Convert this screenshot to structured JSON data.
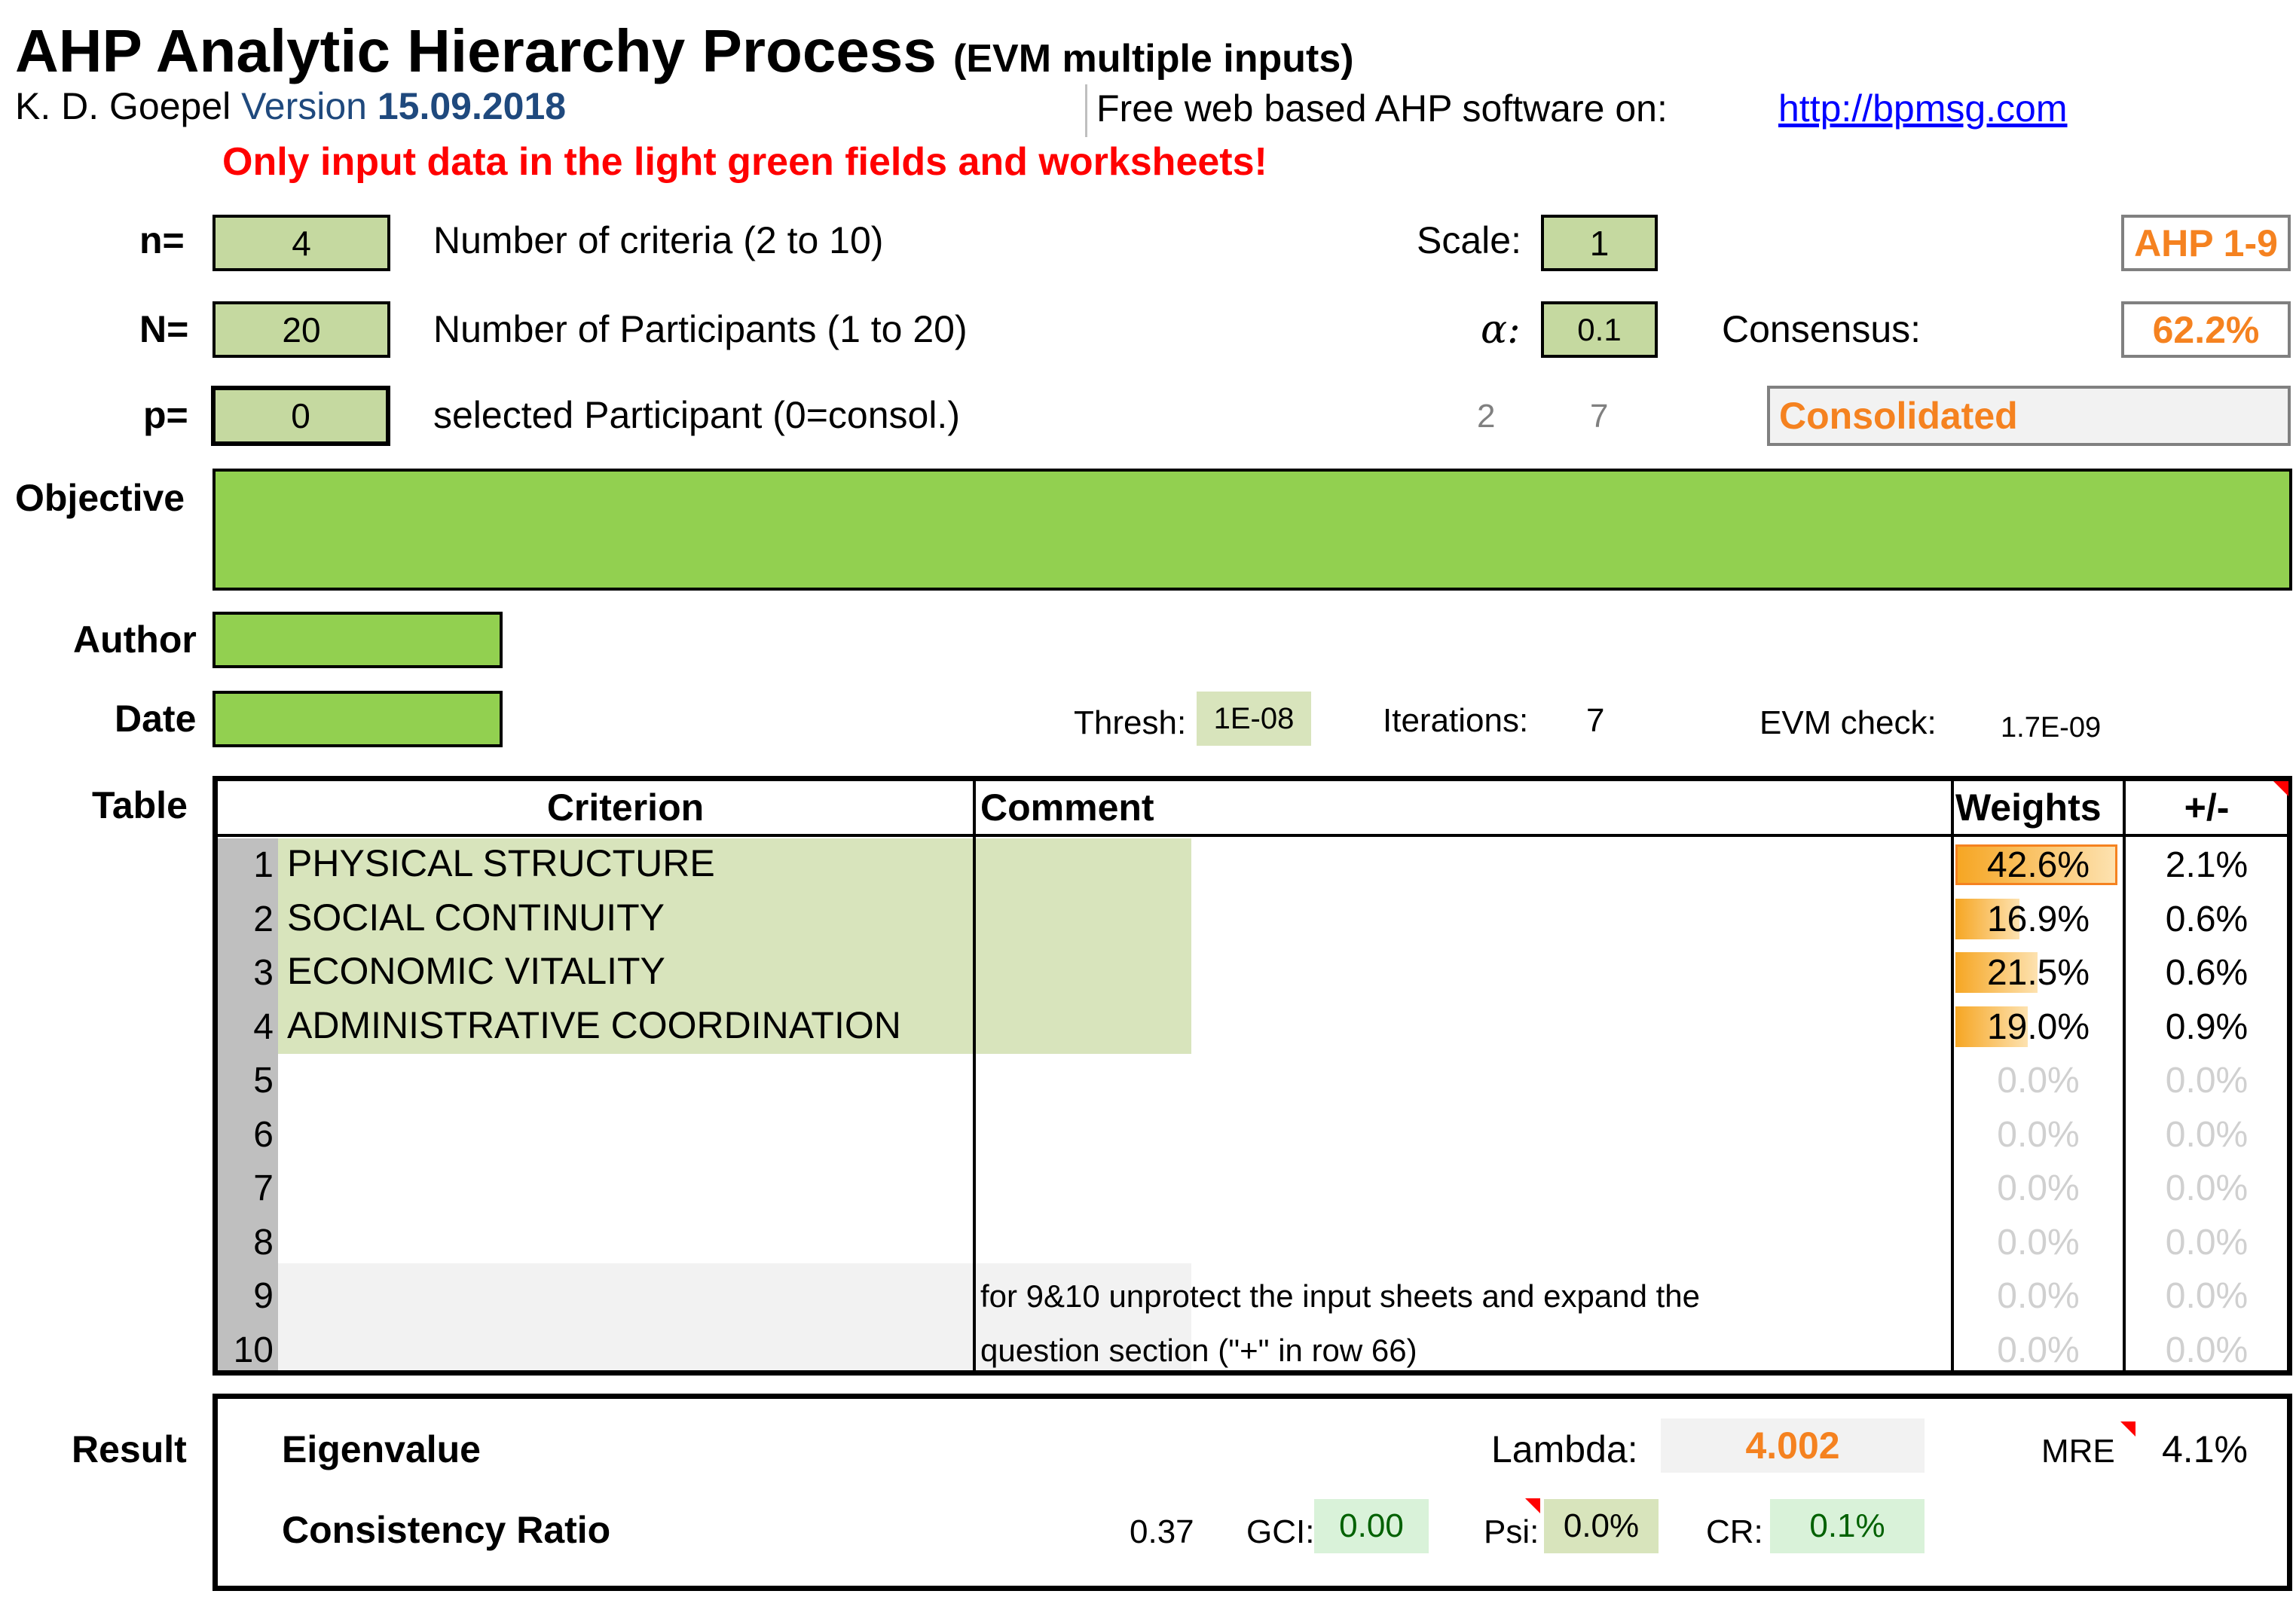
{
  "header": {
    "title": "AHP Analytic Hierarchy Process",
    "subtitle": "(EVM multiple inputs)",
    "author": "K. D. Goepel",
    "version_label": "Version",
    "version": "15.09.2018",
    "web_text": "Free web based AHP software on:",
    "web_link": "http://bpmsg.com",
    "warning": "Only input data in the light green fields and worksheets!"
  },
  "inputs": {
    "n_label": "n=",
    "n_value": "4",
    "n_desc": "Number of criteria (2 to 10)",
    "N_label": "N=",
    "N_value": "20",
    "N_desc": "Number of Participants (1 to 20)",
    "p_label": "p=",
    "p_value": "0",
    "p_desc": "selected Participant (0=consol.)",
    "scale_label": "Scale:",
    "scale_value": "1",
    "scale_name": "AHP 1-9",
    "alpha_label": "α:",
    "alpha_value": "0.1",
    "consensus_label": "Consensus:",
    "consensus_value": "62.2%",
    "aux1": "2",
    "aux2": "7",
    "participant_name": "Consolidated",
    "objective_label": "Objective",
    "author_label": "Author",
    "date_label": "Date",
    "thresh_label": "Thresh:",
    "thresh_value": "1E-08",
    "iterations_label": "Iterations:",
    "iterations_value": "7",
    "evm_label": "EVM check:",
    "evm_value": "1.7E-09"
  },
  "table": {
    "label": "Table",
    "headers": {
      "criterion": "Criterion",
      "comment": "Comment",
      "weights": "Weights",
      "pm": "+/-"
    },
    "rows": [
      {
        "num": "1",
        "criterion": "PHYSICAL STRUCTURE",
        "comment": "",
        "weight": "42.6%",
        "weight_value": 0.426,
        "pm": "2.1%"
      },
      {
        "num": "2",
        "criterion": "SOCIAL CONTINUITY",
        "comment": "",
        "weight": "16.9%",
        "weight_value": 0.169,
        "pm": "0.6%"
      },
      {
        "num": "3",
        "criterion": "ECONOMIC VITALITY",
        "comment": "",
        "weight": "21.5%",
        "weight_value": 0.215,
        "pm": "0.6%"
      },
      {
        "num": "4",
        "criterion": "ADMINISTRATIVE COORDINATION",
        "comment": "",
        "weight": "19.0%",
        "weight_value": 0.19,
        "pm": "0.9%"
      },
      {
        "num": "5",
        "criterion": "",
        "comment": "",
        "weight": "0.0%",
        "weight_value": 0,
        "pm": "0.0%"
      },
      {
        "num": "6",
        "criterion": "",
        "comment": "",
        "weight": "0.0%",
        "weight_value": 0,
        "pm": "0.0%"
      },
      {
        "num": "7",
        "criterion": "",
        "comment": "",
        "weight": "0.0%",
        "weight_value": 0,
        "pm": "0.0%"
      },
      {
        "num": "8",
        "criterion": "",
        "comment": "",
        "weight": "0.0%",
        "weight_value": 0,
        "pm": "0.0%"
      },
      {
        "num": "9",
        "criterion": "",
        "comment": "for 9&10 unprotect the input sheets and expand the",
        "weight": "0.0%",
        "weight_value": 0,
        "pm": "0.0%"
      },
      {
        "num": "10",
        "criterion": "",
        "comment": "question section (\"+\" in row 66)",
        "weight": "0.0%",
        "weight_value": 0,
        "pm": "0.0%"
      }
    ]
  },
  "result": {
    "label": "Result",
    "eigenvalue_label": "Eigenvalue",
    "lambda_label": "Lambda:",
    "lambda_value": "4.002",
    "mre_label": "MRE",
    "mre_value": "4.1%",
    "cr_title": "Consistency Ratio",
    "ri_value": "0.37",
    "gci_label": "GCI:",
    "gci_value": "0.00",
    "psi_label": "Psi:",
    "psi_value": "0.0%",
    "cr_label": "CR:",
    "cr_value": "0.1%"
  },
  "colors": {
    "input_green": "#c5d9a0",
    "bright_green": "#92d050",
    "accent_orange": "#f58220",
    "warning_red": "#ff0000",
    "version_blue": "#1f497d"
  }
}
